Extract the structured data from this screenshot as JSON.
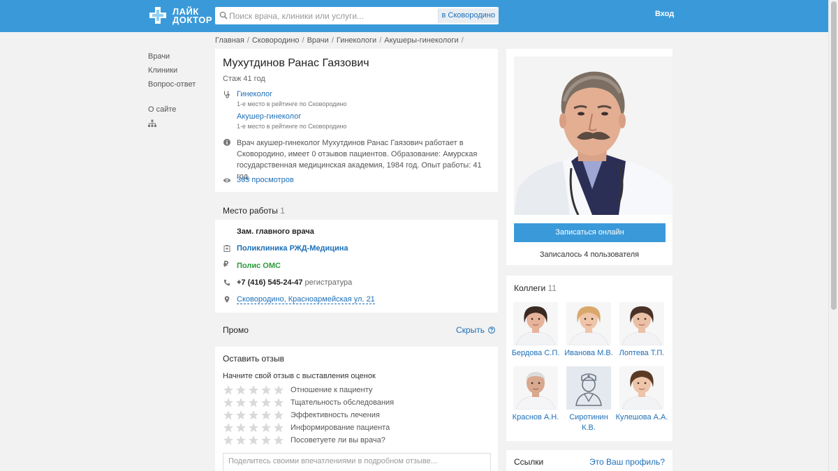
{
  "header": {
    "logo_line1": "ЛАЙК",
    "logo_line2": "ДОКТОР",
    "search_placeholder": "Поиск врача, клиники или услуги...",
    "search_city": "в Сковородино",
    "login": "Вход"
  },
  "breadcrumb": [
    "Главная",
    "Сковородино",
    "Врачи",
    "Гинекологи",
    "Акушеры-гинекологи"
  ],
  "leftnav": {
    "doctors": "Врачи",
    "clinics": "Клиники",
    "qa": "Вопрос-ответ",
    "about": "О сайте"
  },
  "doctor": {
    "name": "Мухутдинов Ранас Гаязович",
    "experience": "Стаж 41 год",
    "specs": [
      {
        "title": "Гинеколог",
        "rank": "1-е место в рейтинге по Сковородино"
      },
      {
        "title": "Акушер-гинеколог",
        "rank": "1-е место в рейтинге по Сковородино"
      }
    ],
    "about": "Врач акушер-гинеколог Мухутдинов Ранас Гаязович работает в Сковородино, имеет 0 отзывов пациентов. Образование: Амурская государственная медицинская академия, 1984 год. Опыт работы: 41 год.",
    "views": "365 просмотров"
  },
  "work": {
    "title": "Место работы",
    "count": "1",
    "position": "Зам. главного врача",
    "clinic": "Поликлиника РЖД-Медицина",
    "insurance": "Полис ОМС",
    "phone": "+7 (416) 545-24-47",
    "phone_note": "регистратура",
    "address": "Сковородино, Красноармейская ул. 21"
  },
  "promo": {
    "title": "Промо",
    "hide": "Скрыть"
  },
  "review": {
    "title": "Оставить отзыв",
    "subtitle": "Начните свой отзыв с выставления оценок",
    "criteria": [
      "Отношение к пациенту",
      "Тщательность обследования",
      "Эффективность лечения",
      "Информирование пациента",
      "Посоветуете ли вы врача?"
    ],
    "placeholder": "Поделитесь своими впечатлениями в подробном отзыве..."
  },
  "booking": {
    "button": "Записаться онлайн",
    "booked": "Записалось 4 пользователя"
  },
  "colleagues": {
    "title": "Коллеги",
    "count": "11",
    "items": [
      {
        "name": "Бердова С.П."
      },
      {
        "name": "Иванова М.В."
      },
      {
        "name": "Лоптева Т.П."
      },
      {
        "name": "Краснов А.Н."
      },
      {
        "name": "Сиротинин К.В."
      },
      {
        "name": "Кулешова А.А."
      }
    ]
  },
  "links": {
    "title": "Ссылки",
    "profile": "Это Ваш профиль?"
  },
  "colors": {
    "header_bg": "#3a9ad9",
    "link": "#1d6fb8",
    "oms": "#2a9a3a"
  }
}
